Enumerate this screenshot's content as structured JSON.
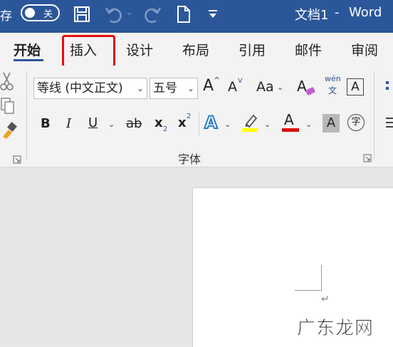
{
  "titlebar": {
    "autosave_label": "存",
    "autosave_state": "关",
    "doc_title": "文档1",
    "separator": "-",
    "app_name": "Word"
  },
  "tabs": [
    {
      "label": "开始",
      "active": true
    },
    {
      "label": "插入",
      "active": false
    },
    {
      "label": "设计",
      "active": false
    },
    {
      "label": "布局",
      "active": false
    },
    {
      "label": "引用",
      "active": false
    },
    {
      "label": "邮件",
      "active": false
    },
    {
      "label": "审阅",
      "active": false
    }
  ],
  "font_group": {
    "font_name": "等线 (中文正文)",
    "font_size": "五号",
    "label": "字体",
    "grow_font": "A",
    "shrink_font": "A",
    "change_case": "Aa",
    "phonetic_top": "wén",
    "phonetic_bottom": "文",
    "bold": "B",
    "italic": "I",
    "underline": "U",
    "strikethrough": "ab",
    "subscript": "x",
    "subscript_mark": "2",
    "superscript": "x",
    "superscript_mark": "2",
    "text_effects": "A",
    "font_color": "A",
    "char_shading": "A",
    "enclose_char": "字",
    "char_border": "A"
  },
  "colors": {
    "brand": "#2b579a",
    "highlight_yellow": "#ffff00",
    "font_red": "#e01010",
    "annotation_red": "#e01010"
  },
  "watermark": "广东龙网"
}
